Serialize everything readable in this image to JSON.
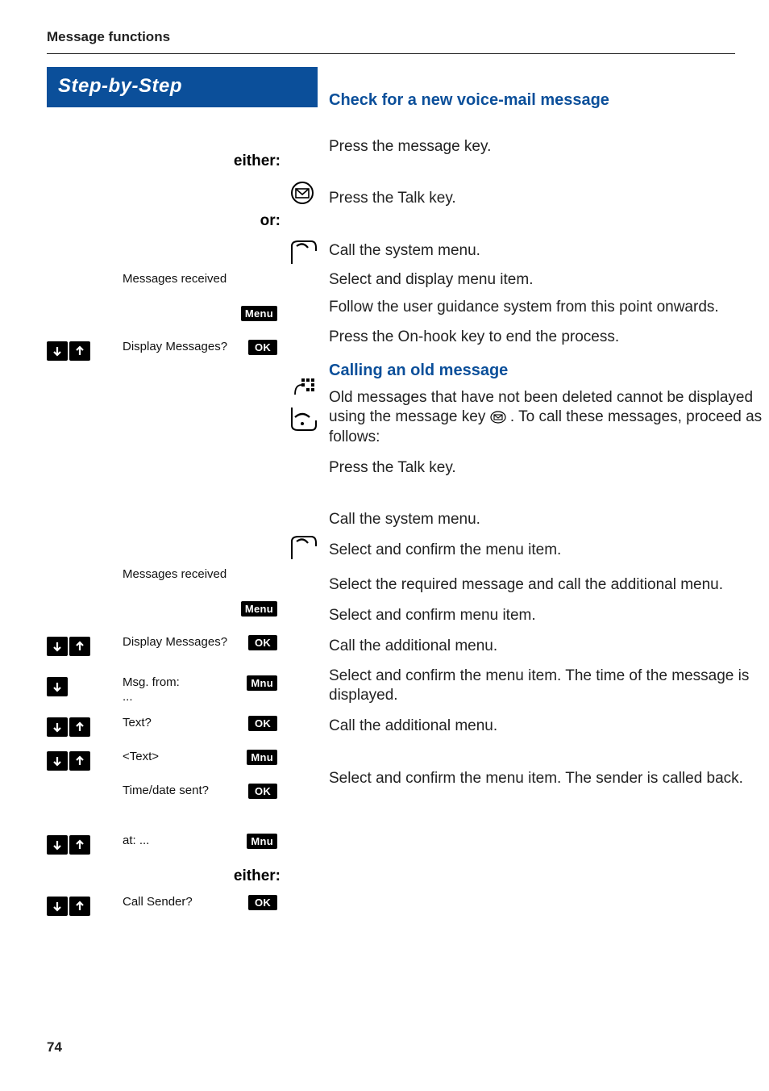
{
  "header": {
    "section_title": "Message functions"
  },
  "sidebar": {
    "banner": "Step-by-Step"
  },
  "labels": {
    "either": "either:",
    "or": "or:"
  },
  "buttons": {
    "menu": "Menu",
    "ok": "OK",
    "mnu": "Mnu"
  },
  "left": {
    "messages_received_1": "Messages received",
    "display_messages_1": "Display Messages?",
    "messages_received_2": "Messages received",
    "display_messages_2": "Display Messages?",
    "msg_from": "Msg. from:\n...",
    "text_q": "Text?",
    "text_placeholder": "<Text>",
    "time_date": "Time/date sent?",
    "at": "at: ...",
    "call_sender": "Call Sender?"
  },
  "right": {
    "h1": "Check for a new voice-mail message",
    "r1": "Press the message key.",
    "r2": "Press the Talk key.",
    "r3": "Call the system menu.",
    "r4": "Select and display menu item.",
    "r5": "Follow the user guidance system from this point onwards.",
    "r6": "Press the On-hook key to end the process.",
    "h2": "Calling an old message",
    "p1a": "Old messages that have not been deleted cannot be displayed using the message key ",
    "p1b": ". To call these messages, proceed as follows:",
    "r7": "Press the Talk key.",
    "r8": "Call the system menu.",
    "r9": "Select and confirm the menu item.",
    "r10": "Select the required message and call the additional menu.",
    "r11": "Select and confirm menu item.",
    "r12": "Call the additional menu.",
    "r13": "Select and confirm the menu item. The time of the message is displayed.",
    "r14": "Call the additional menu.",
    "r15": "Select and confirm the menu item. The sender is called back."
  },
  "page_number": "74"
}
